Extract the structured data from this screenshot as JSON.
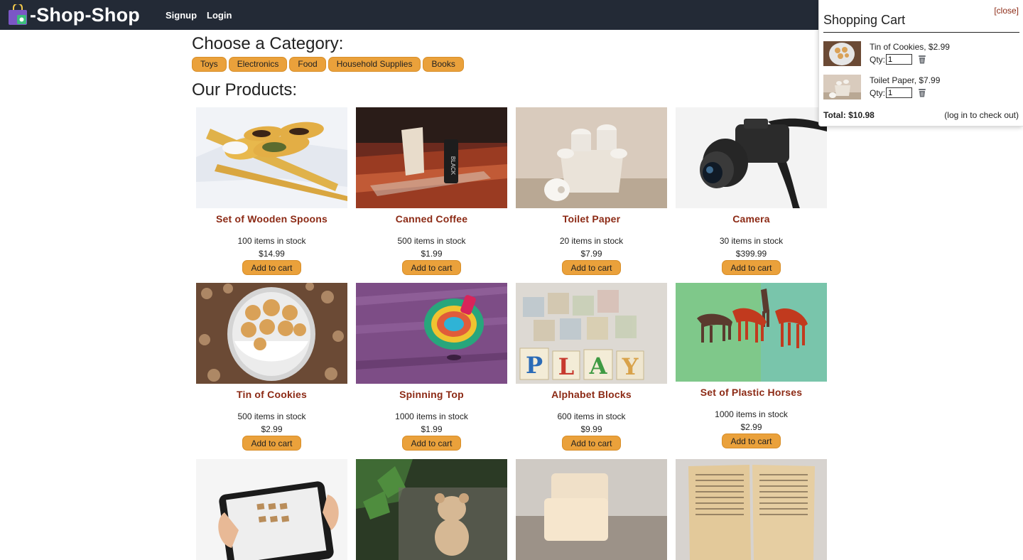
{
  "nav": {
    "brand": "-Shop-Shop",
    "links": [
      "Signup",
      "Login"
    ]
  },
  "categories": {
    "heading": "Choose a Category:",
    "items": [
      "Toys",
      "Electronics",
      "Food",
      "Household Supplies",
      "Books"
    ]
  },
  "products": {
    "heading": "Our Products:",
    "add_label": "Add to cart",
    "items": [
      {
        "name": "Set of Wooden Spoons",
        "stock": "100 items in stock",
        "price": "$14.99"
      },
      {
        "name": "Canned Coffee",
        "stock": "500 items in stock",
        "price": "$1.99"
      },
      {
        "name": "Toilet Paper",
        "stock": "20 items in stock",
        "price": "$7.99"
      },
      {
        "name": "Camera",
        "stock": "30 items in stock",
        "price": "$399.99"
      },
      {
        "name": "Tin of Cookies",
        "stock": "500 items in stock",
        "price": "$2.99"
      },
      {
        "name": "Spinning Top",
        "stock": "1000 items in stock",
        "price": "$1.99"
      },
      {
        "name": "Alphabet Blocks",
        "stock": "600 items in stock",
        "price": "$9.99"
      },
      {
        "name": "Set of Plastic Horses",
        "stock": "1000 items in stock",
        "price": "$2.99"
      }
    ],
    "block_letters": [
      "P",
      "L",
      "A",
      "Y"
    ]
  },
  "cart": {
    "title": "Shopping Cart",
    "close_label": "[close]",
    "qty_label": "Qty:",
    "items": [
      {
        "name": "Tin of Cookies, $2.99",
        "qty": "1"
      },
      {
        "name": "Toilet Paper, $7.99",
        "qty": "1"
      }
    ],
    "total": "Total: $10.98",
    "checkout_note": "(log in to check out)"
  },
  "colors": {
    "navbar": "#232a36",
    "accent_button": "#eaa13b",
    "product_name": "#8c2a15"
  }
}
